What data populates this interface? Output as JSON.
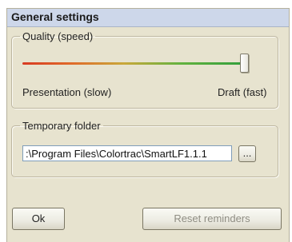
{
  "window": {
    "title": "General settings"
  },
  "quality": {
    "legend": "Quality (speed)",
    "left_label": "Presentation (slow)",
    "right_label": "Draft (fast)",
    "slider_value_fraction": 1.0,
    "gradient_colors": [
      "#d83a22",
      "#c9a83a",
      "#2f9e3c"
    ]
  },
  "folder": {
    "legend": "Temporary folder",
    "path_value": ":\\Program Files\\Colortrac\\SmartLF1.1.1",
    "browse_label": "..."
  },
  "footer": {
    "ok_label": "Ok",
    "reset_label": "Reset reminders",
    "reset_enabled": false
  }
}
